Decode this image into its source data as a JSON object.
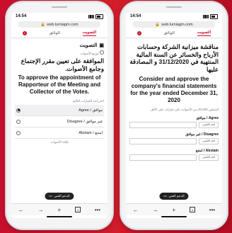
{
  "status": {
    "time": "14:54"
  },
  "url": "web.lumiagm.com",
  "tabs": {
    "voting": "التصويت",
    "docs": "الوثائق",
    "messages_badge": "1"
  },
  "left": {
    "section_title": "التصويت",
    "weighted_note": "توزيع الأصوات",
    "resolution_ar": "الموافقة على تعيين مقرر الإجتماع وجامع الأصوات.",
    "resolution_en": "To approve the appointment of Rapporteur of the Meeting and Collector of the Votes.",
    "choose_note": "اختر أحد الخيارات التالية",
    "options": [
      {
        "label": "Agree / موافق",
        "selected": true
      },
      {
        "label": "Disagree / غير موافق",
        "selected": false
      },
      {
        "label": "Abstain / امتنع",
        "selected": false
      }
    ],
    "cancel_note": "إلغاء الأصوات"
  },
  "right": {
    "resolution_ar": "مناقشة ميزانية الشركة وحسابات الأرباح والخسائر عن السنة المالية المنتهية في 31/12/2020 و المصادقة عليها",
    "resolution_en": "Consider and approve the company's financial statements for the year ended December 31, 2020",
    "votes_note": "المتبقي 20,000 من الأصوات على خيارات على الأقل",
    "fields": [
      {
        "label": "Agree / موافق",
        "tag": "الحد الأقصى"
      },
      {
        "label": "Disagree / غير موافق",
        "tag": "الحد الأقصى"
      },
      {
        "label": "Abstain / امتنع",
        "tag": "الحد الأقصى"
      }
    ]
  },
  "support_label": "الدعم الفني",
  "tab_count": "4"
}
